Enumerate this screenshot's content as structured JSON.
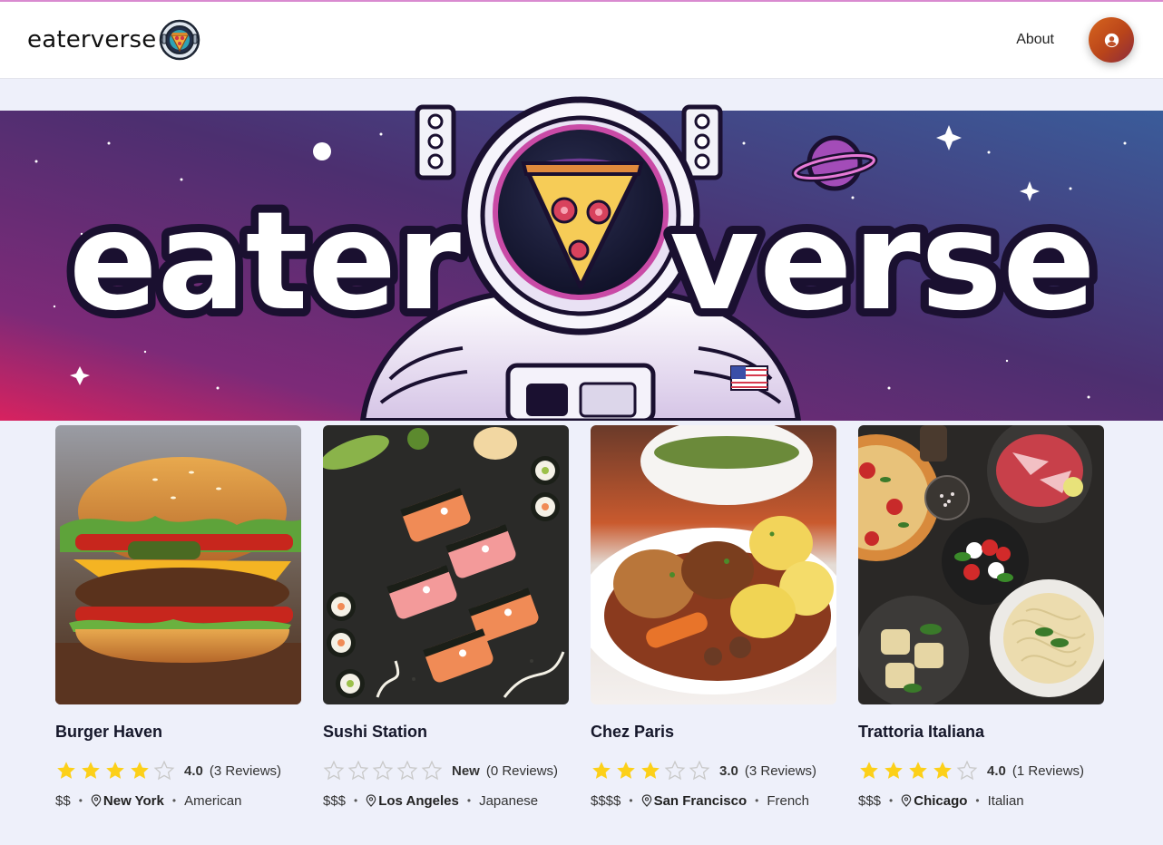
{
  "header": {
    "brand": "eaterverse",
    "nav_about": "About"
  },
  "hero": {
    "text_left": "eater",
    "text_right": "verse"
  },
  "restaurants": [
    {
      "name": "Burger Haven",
      "stars": 4,
      "rating": "4.0",
      "reviews": "(3 Reviews)",
      "price": "$$",
      "city": "New York",
      "cuisine": "American"
    },
    {
      "name": "Sushi Station",
      "stars": 0,
      "rating": "New",
      "reviews": "(0 Reviews)",
      "price": "$$$",
      "city": "Los Angeles",
      "cuisine": "Japanese"
    },
    {
      "name": "Chez Paris",
      "stars": 3,
      "rating": "3.0",
      "reviews": "(3 Reviews)",
      "price": "$$$$",
      "city": "San Francisco",
      "cuisine": "French"
    },
    {
      "name": "Trattoria Italiana",
      "stars": 4,
      "rating": "4.0",
      "reviews": "(1 Reviews)",
      "price": "$$$",
      "city": "Chicago",
      "cuisine": "Italian"
    }
  ],
  "icons": {
    "logo": "astronaut-pizza-logo-icon",
    "avatar": "user-icon",
    "location": "map-pin-icon",
    "star": "star-icon"
  },
  "colors": {
    "star_filled": "#fcd019",
    "star_empty": "#c9c9c9",
    "avatar_gradient_start": "#d7651e",
    "avatar_gradient_end": "#8b2b3e"
  }
}
